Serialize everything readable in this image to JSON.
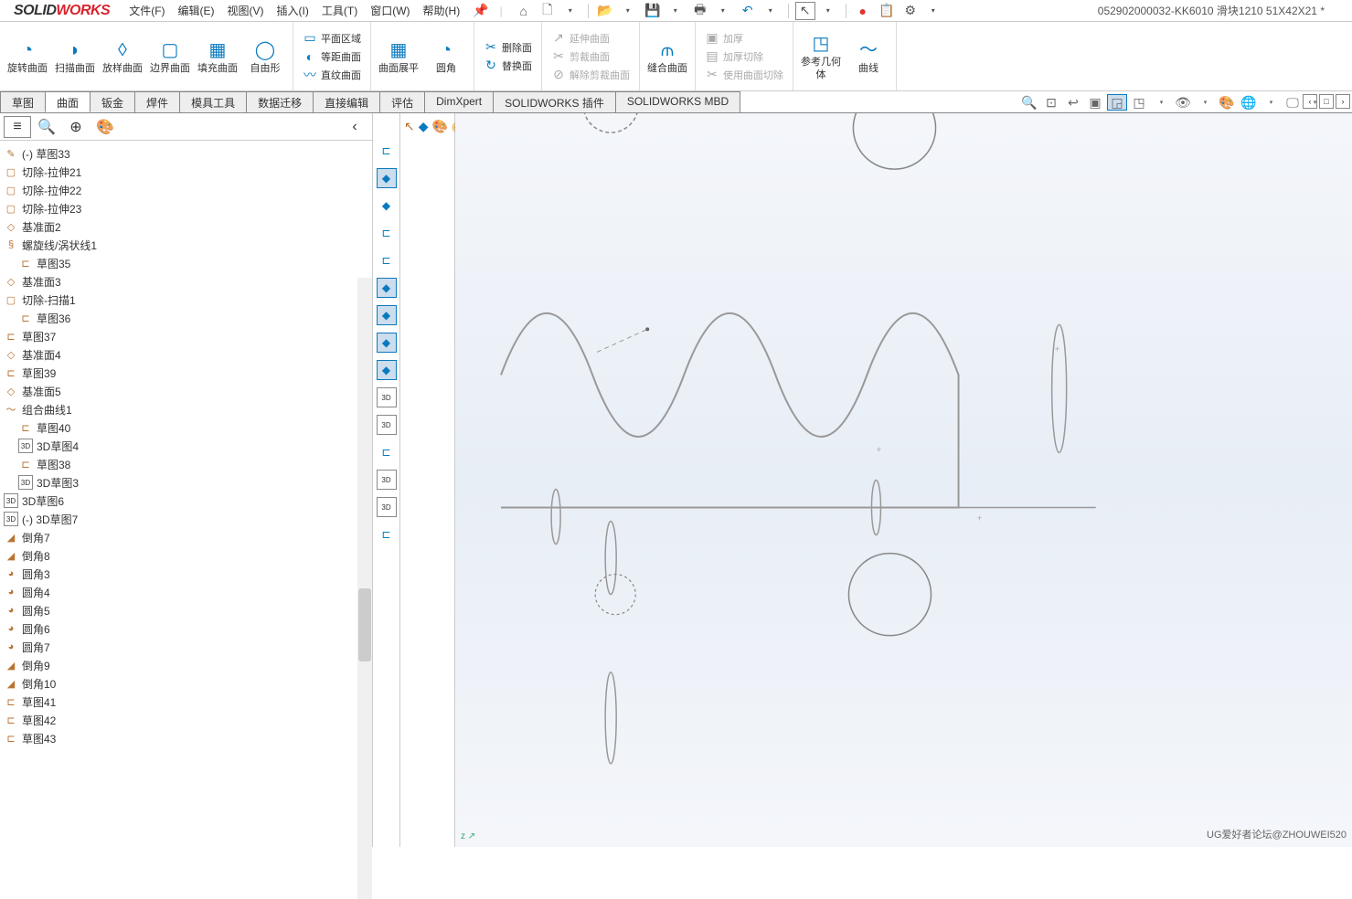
{
  "app": {
    "logo1": "SOLID",
    "logo2": "WORKS"
  },
  "doc_title": "052902000032-KK6010 滑块1210  51X42X21 *",
  "menu": [
    "文件(F)",
    "编辑(E)",
    "视图(V)",
    "插入(I)",
    "工具(T)",
    "窗口(W)",
    "帮助(H)"
  ],
  "pin": "📌",
  "ribbon": {
    "g1": [
      {
        "icon": "◔",
        "label": "旋转曲面"
      },
      {
        "icon": "◗",
        "label": "扫描曲面"
      },
      {
        "icon": "◊",
        "label": "放样曲面"
      },
      {
        "icon": "▢",
        "label": "边界曲面"
      },
      {
        "icon": "▦",
        "label": "填充曲面"
      },
      {
        "icon": "◯",
        "label": "自由形"
      }
    ],
    "g2col": [
      {
        "icon": "▭",
        "label": "平面区域"
      },
      {
        "icon": "◐",
        "label": "等距曲面"
      },
      {
        "icon": "〰",
        "label": "直纹曲面"
      }
    ],
    "g3": [
      {
        "icon": "▦",
        "label": "曲面展平"
      },
      {
        "icon": "◔",
        "label": "圆角"
      }
    ],
    "g4col": [
      {
        "icon": "✂",
        "label": "删除面"
      },
      {
        "icon": "↻",
        "label": "替换面"
      }
    ],
    "g5col": [
      {
        "icon": "↗",
        "label": "延伸曲面",
        "disabled": true
      },
      {
        "icon": "✂",
        "label": "剪裁曲面",
        "disabled": true
      },
      {
        "icon": "⊘",
        "label": "解除剪裁曲面",
        "disabled": true
      }
    ],
    "g6": [
      {
        "icon": "⫙",
        "label": "缝合曲面"
      }
    ],
    "g7col": [
      {
        "icon": "▣",
        "label": "加厚",
        "disabled": true
      },
      {
        "icon": "▤",
        "label": "加厚切除",
        "disabled": true
      },
      {
        "icon": "✂",
        "label": "使用曲面切除",
        "disabled": true
      }
    ],
    "g8": [
      {
        "icon": "◳",
        "label": "参考几何体"
      },
      {
        "icon": "〜",
        "label": "曲线"
      }
    ]
  },
  "tabs": [
    "草图",
    "曲面",
    "钣金",
    "焊件",
    "模具工具",
    "数据迁移",
    "直接编辑",
    "评估",
    "DimXpert",
    "SOLIDWORKS 插件",
    "SOLIDWORKS MBD"
  ],
  "active_tab": 1,
  "side_tabs": [
    "≡",
    "🔍",
    "⊕",
    "🎨"
  ],
  "flyout_tools": [
    "↖",
    "◆",
    "🎨",
    "◉"
  ],
  "tree": [
    {
      "icon": "✎",
      "label": "(-) 草图33",
      "indent": 0
    },
    {
      "icon": "▢",
      "label": "切除-拉伸21",
      "indent": 0
    },
    {
      "icon": "▢",
      "label": "切除-拉伸22",
      "indent": 0
    },
    {
      "icon": "▢",
      "label": "切除-拉伸23",
      "indent": 0
    },
    {
      "icon": "◇",
      "label": "基准面2",
      "indent": 0
    },
    {
      "icon": "§",
      "label": "螺旋线/涡状线1",
      "indent": 0
    },
    {
      "icon": "⊏",
      "label": "草图35",
      "indent": 1
    },
    {
      "icon": "◇",
      "label": "基准面3",
      "indent": 0
    },
    {
      "icon": "▢",
      "label": "切除-扫描1",
      "indent": 0
    },
    {
      "icon": "⊏",
      "label": "草图36",
      "indent": 1
    },
    {
      "icon": "⊏",
      "label": "草图37",
      "indent": 0
    },
    {
      "icon": "◇",
      "label": "基准面4",
      "indent": 0
    },
    {
      "icon": "⊏",
      "label": "草图39",
      "indent": 0
    },
    {
      "icon": "◇",
      "label": "基准面5",
      "indent": 0
    },
    {
      "icon": "〜",
      "label": "组合曲线1",
      "indent": 0
    },
    {
      "icon": "⊏",
      "label": "草图40",
      "indent": 1
    },
    {
      "icon": "3D",
      "label": "3D草图4",
      "indent": 1
    },
    {
      "icon": "⊏",
      "label": "草图38",
      "indent": 1
    },
    {
      "icon": "3D",
      "label": "3D草图3",
      "indent": 1
    },
    {
      "icon": "3D",
      "label": "3D草图6",
      "indent": 0
    },
    {
      "icon": "3D",
      "label": "(-) 3D草图7",
      "indent": 0
    },
    {
      "icon": "◢",
      "label": "倒角7",
      "indent": 0
    },
    {
      "icon": "◢",
      "label": "倒角8",
      "indent": 0
    },
    {
      "icon": "◕",
      "label": "圆角3",
      "indent": 0
    },
    {
      "icon": "◕",
      "label": "圆角4",
      "indent": 0
    },
    {
      "icon": "◕",
      "label": "圆角5",
      "indent": 0
    },
    {
      "icon": "◕",
      "label": "圆角6",
      "indent": 0
    },
    {
      "icon": "◕",
      "label": "圆角7",
      "indent": 0
    },
    {
      "icon": "◢",
      "label": "倒角9",
      "indent": 0
    },
    {
      "icon": "◢",
      "label": "倒角10",
      "indent": 0
    },
    {
      "icon": "⊏",
      "label": "草图41",
      "indent": 0
    },
    {
      "icon": "⊏",
      "label": "草图42",
      "indent": 0
    },
    {
      "icon": "⊏",
      "label": "草图43",
      "indent": 0
    }
  ],
  "model_strip": [
    "⊏",
    "◆",
    "◆",
    "⊏",
    "⊏",
    "◆",
    "◆",
    "◆",
    "◆",
    "3D",
    "3D",
    "⊏",
    "3D",
    "3D",
    "⊏"
  ],
  "watermark": "UG爱好者论坛@ZHOUWEI520",
  "triad": "z ↗"
}
